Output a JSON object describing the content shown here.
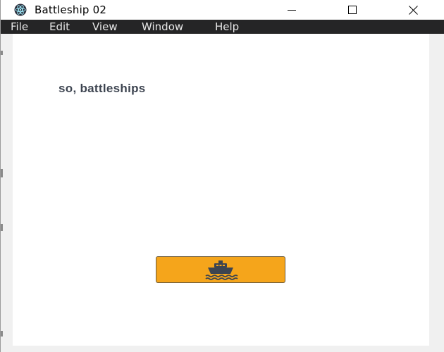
{
  "window": {
    "title": "Battleship 02",
    "app_icon": "electron-atom-icon",
    "controls": [
      "minimize-icon",
      "maximize-icon",
      "close-icon"
    ]
  },
  "menu": {
    "items": [
      {
        "label": "File"
      },
      {
        "label": "Edit"
      },
      {
        "label": "View"
      },
      {
        "label": "Window"
      },
      {
        "label": "Help"
      }
    ]
  },
  "main": {
    "heading": "so, battleships",
    "action_button": {
      "icon": "ship-icon",
      "color": "#f5a51b"
    }
  },
  "colors": {
    "menubar_bg": "#252526",
    "heading_text": "#3d4450",
    "button_accent": "#f5a51b",
    "icon_color": "#3d4450"
  }
}
